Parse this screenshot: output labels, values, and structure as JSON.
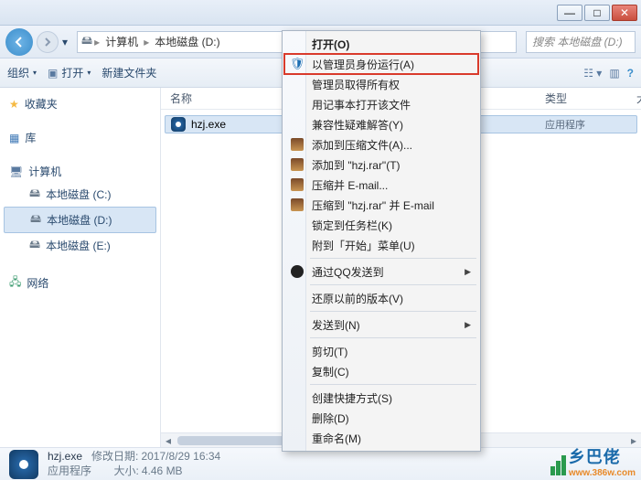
{
  "titlebar": {
    "min": "—",
    "max": "□",
    "close": "✕"
  },
  "nav": {
    "back": "←",
    "fwd": "→",
    "addr_segs": [
      "计算机",
      "本地磁盘 (D:)"
    ],
    "search_placeholder": "搜索 本地磁盘 (D:)"
  },
  "toolbar": {
    "organize": "组织",
    "open": "打开",
    "newfolder": "新建文件夹"
  },
  "sidebar": {
    "favorites": "收藏夹",
    "libraries": "库",
    "computer": "计算机",
    "drives": [
      "本地磁盘 (C:)",
      "本地磁盘 (D:)",
      "本地磁盘 (E:)"
    ],
    "network": "网络"
  },
  "columns": {
    "name": "名称",
    "type": "类型",
    "size": "大"
  },
  "file": {
    "name": "hzj.exe",
    "app_row": "应用程序",
    "app_row2": "应用程序"
  },
  "details": {
    "filename": "hzj.exe",
    "apptype": "应用程序",
    "mod_label": "修改日期:",
    "mod_val": "2017/8/29 16:34",
    "size_label": "大小:",
    "size_val": "4.46 MB"
  },
  "ctx": {
    "open": "打开(O)",
    "runas": "以管理员身份运行(A)",
    "take": "管理员取得所有权",
    "notepad": "用记事本打开该文件",
    "compat": "兼容性疑难解答(Y)",
    "addarchive": "添加到压缩文件(A)...",
    "addrar": "添加到 \"hzj.rar\"(T)",
    "ziemail": "压缩并 E-mail...",
    "ziemail2": "压缩到 \"hzj.rar\" 并 E-mail",
    "pin": "锁定到任务栏(K)",
    "pinstart": "附到「开始」菜单(U)",
    "qq": "通过QQ发送到",
    "restore": "还原以前的版本(V)",
    "sendto": "发送到(N)",
    "cut": "剪切(T)",
    "copy": "复制(C)",
    "shortcut": "创建快捷方式(S)",
    "delete": "删除(D)",
    "rename": "重命名(M)"
  },
  "watermark": {
    "cn": "乡巴佬",
    "url": "www.386w.com"
  }
}
